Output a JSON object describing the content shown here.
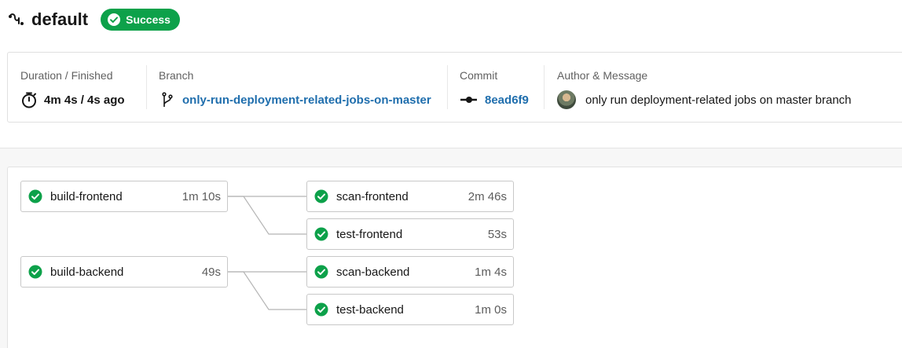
{
  "header": {
    "workflow_icon": "workflow-icon",
    "title": "default",
    "status": "Success",
    "status_icon": "check-circle-icon",
    "status_color": "#0da14a"
  },
  "summary": {
    "duration": {
      "label": "Duration / Finished",
      "value": "4m 4s / 4s ago",
      "icon": "stopwatch-icon"
    },
    "branch": {
      "label": "Branch",
      "value": "only-run-deployment-related-jobs-on-master",
      "icon": "git-branch-icon"
    },
    "commit": {
      "label": "Commit",
      "value": "8ead6f9",
      "icon": "git-commit-icon"
    },
    "author": {
      "label": "Author & Message",
      "message": "only run deployment-related jobs on master branch"
    }
  },
  "colors": {
    "link": "#1f6ead",
    "success": "#0da14a"
  },
  "jobs": [
    {
      "name": "build-frontend",
      "duration": "1m 10s",
      "status": "success"
    },
    {
      "name": "scan-frontend",
      "duration": "2m 46s",
      "status": "success"
    },
    {
      "name": "test-frontend",
      "duration": "53s",
      "status": "success"
    },
    {
      "name": "build-backend",
      "duration": "49s",
      "status": "success"
    },
    {
      "name": "scan-backend",
      "duration": "1m 4s",
      "status": "success"
    },
    {
      "name": "test-backend",
      "duration": "1m 0s",
      "status": "success"
    }
  ]
}
